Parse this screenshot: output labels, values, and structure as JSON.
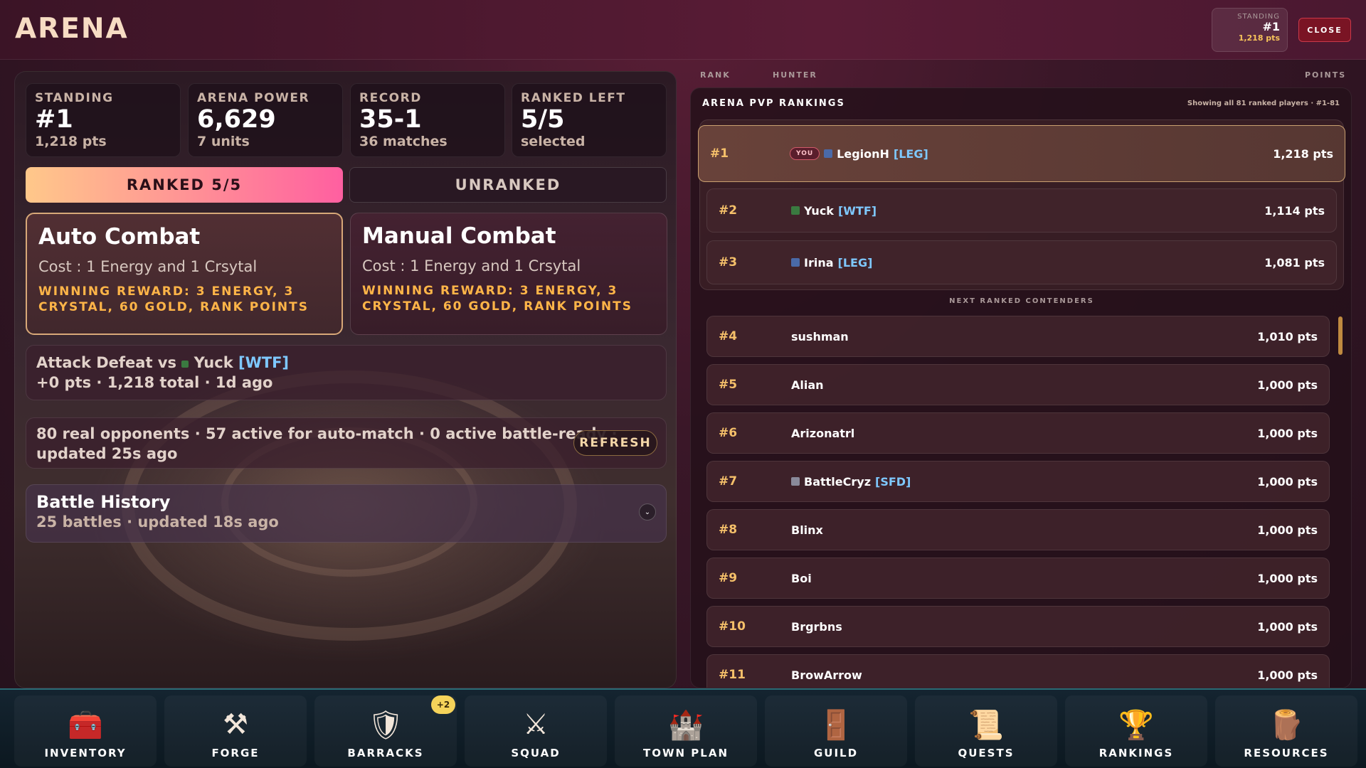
{
  "header": {
    "title": "ARENA",
    "standing_label": "STANDING",
    "standing_value": "#1",
    "standing_points": "1,218 pts",
    "close_label": "CLOSE"
  },
  "stats": [
    {
      "label": "STANDING",
      "value": "#1",
      "sub": "1,218 pts"
    },
    {
      "label": "ARENA POWER",
      "value": "6,629",
      "sub": "7 units"
    },
    {
      "label": "RECORD",
      "value": "35-1",
      "sub": "36 matches"
    },
    {
      "label": "RANKED LEFT",
      "value": "5/5",
      "sub": "selected"
    }
  ],
  "tabs": {
    "ranked": "RANKED 5/5",
    "unranked": "UNRANKED"
  },
  "modes": {
    "auto": {
      "title": "Auto Combat",
      "cost": "Cost : 1 Energy and 1 Crsytal",
      "reward": "WINNING REWARD: 3 ENERGY, 3 CRYSTAL, 60 GOLD, RANK POINTS"
    },
    "manual": {
      "title": "Manual Combat",
      "cost": "Cost : 1 Energy and 1 Crsytal",
      "reward": "WINNING REWARD: 3 ENERGY, 3 CRYSTAL, 60 GOLD, RANK POINTS"
    }
  },
  "last_battle": {
    "prefix": "Attack Defeat vs",
    "opponent": "Yuck",
    "tag": "[WTF]",
    "detail": "+0 pts · 1,218 total · 1d ago"
  },
  "opponents": {
    "text": "80 real opponents · 57 active for auto-match · 0 active battle-ready ·",
    "updated": "updated 25s ago",
    "refresh_label": "REFRESH"
  },
  "history": {
    "title": "Battle History",
    "sub": "25 battles · updated 18s ago",
    "chevron": "⌄"
  },
  "quick_icons": [
    "lightning-icon",
    "clock-icon",
    "lightning-icon",
    "hammer-icon",
    "book-icon"
  ],
  "rankings": {
    "col_rank": "RANK",
    "col_hunter": "HUNTER",
    "col_points": "POINTS",
    "title": "ARENA PVP RANKINGS",
    "showing": "Showing all 81 ranked players · #1-81",
    "you_label": "YOU",
    "next_label": "NEXT RANKED CONTENDERS",
    "top": [
      {
        "rank": "#1",
        "name": "LegionH",
        "tag": "[LEG]",
        "points": "1,218 pts",
        "you": true
      },
      {
        "rank": "#2",
        "name": "Yuck",
        "tag": "[WTF]",
        "points": "1,114 pts"
      },
      {
        "rank": "#3",
        "name": "Irina",
        "tag": "[LEG]",
        "points": "1,081 pts"
      }
    ],
    "rest": [
      {
        "rank": "#4",
        "name": "sushman",
        "tag": "",
        "points": "1,010 pts"
      },
      {
        "rank": "#5",
        "name": "Alian",
        "tag": "",
        "points": "1,000 pts"
      },
      {
        "rank": "#6",
        "name": "Arizonatrl",
        "tag": "",
        "points": "1,000 pts"
      },
      {
        "rank": "#7",
        "name": "BattleCryz",
        "tag": "[SFD]",
        "points": "1,000 pts"
      },
      {
        "rank": "#8",
        "name": "Blinx",
        "tag": "",
        "points": "1,000 pts"
      },
      {
        "rank": "#9",
        "name": "Boi",
        "tag": "",
        "points": "1,000 pts"
      },
      {
        "rank": "#10",
        "name": "Brgrbns",
        "tag": "",
        "points": "1,000 pts"
      },
      {
        "rank": "#11",
        "name": "BrowArrow",
        "tag": "",
        "points": "1,000 pts"
      }
    ]
  },
  "nav": [
    {
      "label": "INVENTORY",
      "icon": "🧰"
    },
    {
      "label": "FORGE",
      "icon": "⚒"
    },
    {
      "label": "BARRACKS",
      "icon": "🛡"
    },
    {
      "label": "SQUAD",
      "icon": "⚔"
    },
    {
      "label": "TOWN PLAN",
      "icon": "🏰"
    },
    {
      "label": "GUILD",
      "icon": "🚪"
    },
    {
      "label": "QUESTS",
      "icon": "📜"
    },
    {
      "label": "RANKINGS",
      "icon": "🏆"
    },
    {
      "label": "RESOURCES",
      "icon": "🪵"
    }
  ],
  "barracks_badge": "+2",
  "colors": {
    "accent_gold": "#f5c06a",
    "tag_blue": "#7ec8ff",
    "reward_orange": "#ffb548"
  }
}
